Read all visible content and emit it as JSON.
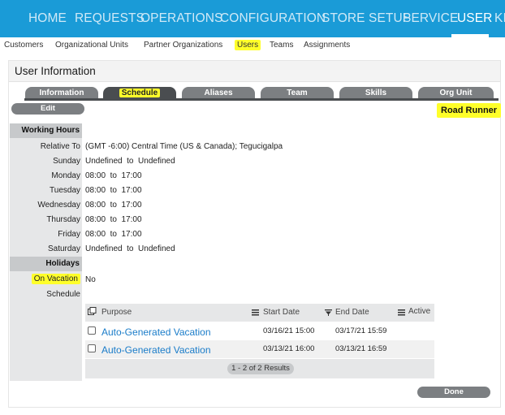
{
  "topnav": {
    "items": [
      "HOME",
      "REQUESTS",
      "OPERATIONS",
      "CONFIGURATION",
      "STORE SETUP",
      "SERVICE",
      "USER",
      "KI"
    ],
    "active": "USER"
  },
  "subnav": {
    "items": [
      "Customers",
      "Organizational Units",
      "Partner Organizations",
      "Users",
      "Teams",
      "Assignments"
    ],
    "active": "Users"
  },
  "panel": {
    "title": "User Information"
  },
  "tabs": [
    "Information",
    "Schedule",
    "Aliases",
    "Team",
    "Skills",
    "Org Unit"
  ],
  "active_tab": "Schedule",
  "edit_label": "Edit",
  "user_name": "Road Runner",
  "working_hours": {
    "section_label": "Working Hours",
    "rows": [
      {
        "label": "Relative To",
        "value": "(GMT -6:00) Central Time (US & Canada); Tegucigalpa"
      },
      {
        "label": "Sunday",
        "value": "Undefined  to  Undefined"
      },
      {
        "label": "Monday",
        "value": "08:00  to  17:00"
      },
      {
        "label": "Tuesday",
        "value": "08:00  to  17:00"
      },
      {
        "label": "Wednesday",
        "value": "08:00  to  17:00"
      },
      {
        "label": "Thursday",
        "value": "08:00  to  17:00"
      },
      {
        "label": "Friday",
        "value": "08:00  to  17:00"
      },
      {
        "label": "Saturday",
        "value": "Undefined  to  Undefined"
      }
    ]
  },
  "holidays": {
    "section_label": "Holidays",
    "on_vacation_label": "On Vacation",
    "on_vacation_value": "No",
    "schedule_label": "Schedule"
  },
  "vacation_table": {
    "columns": [
      "Purpose",
      "Start Date",
      "End Date",
      "Active"
    ],
    "rows": [
      {
        "purpose": "Auto-Generated Vacation",
        "start": "03/16/21 15:00",
        "end": "03/17/21 15:59"
      },
      {
        "purpose": "Auto-Generated Vacation",
        "start": "03/13/21 16:00",
        "end": "03/13/21 16:59"
      }
    ],
    "results": "1 - 2 of 2 Results"
  },
  "done_label": "Done",
  "colors": {
    "nav_blue": "#1a9bd7",
    "highlight": "#ffff2a",
    "tab_gray": "#7c7f82",
    "tab_active": "#4a4d50",
    "link_blue": "#1a7cc9"
  }
}
